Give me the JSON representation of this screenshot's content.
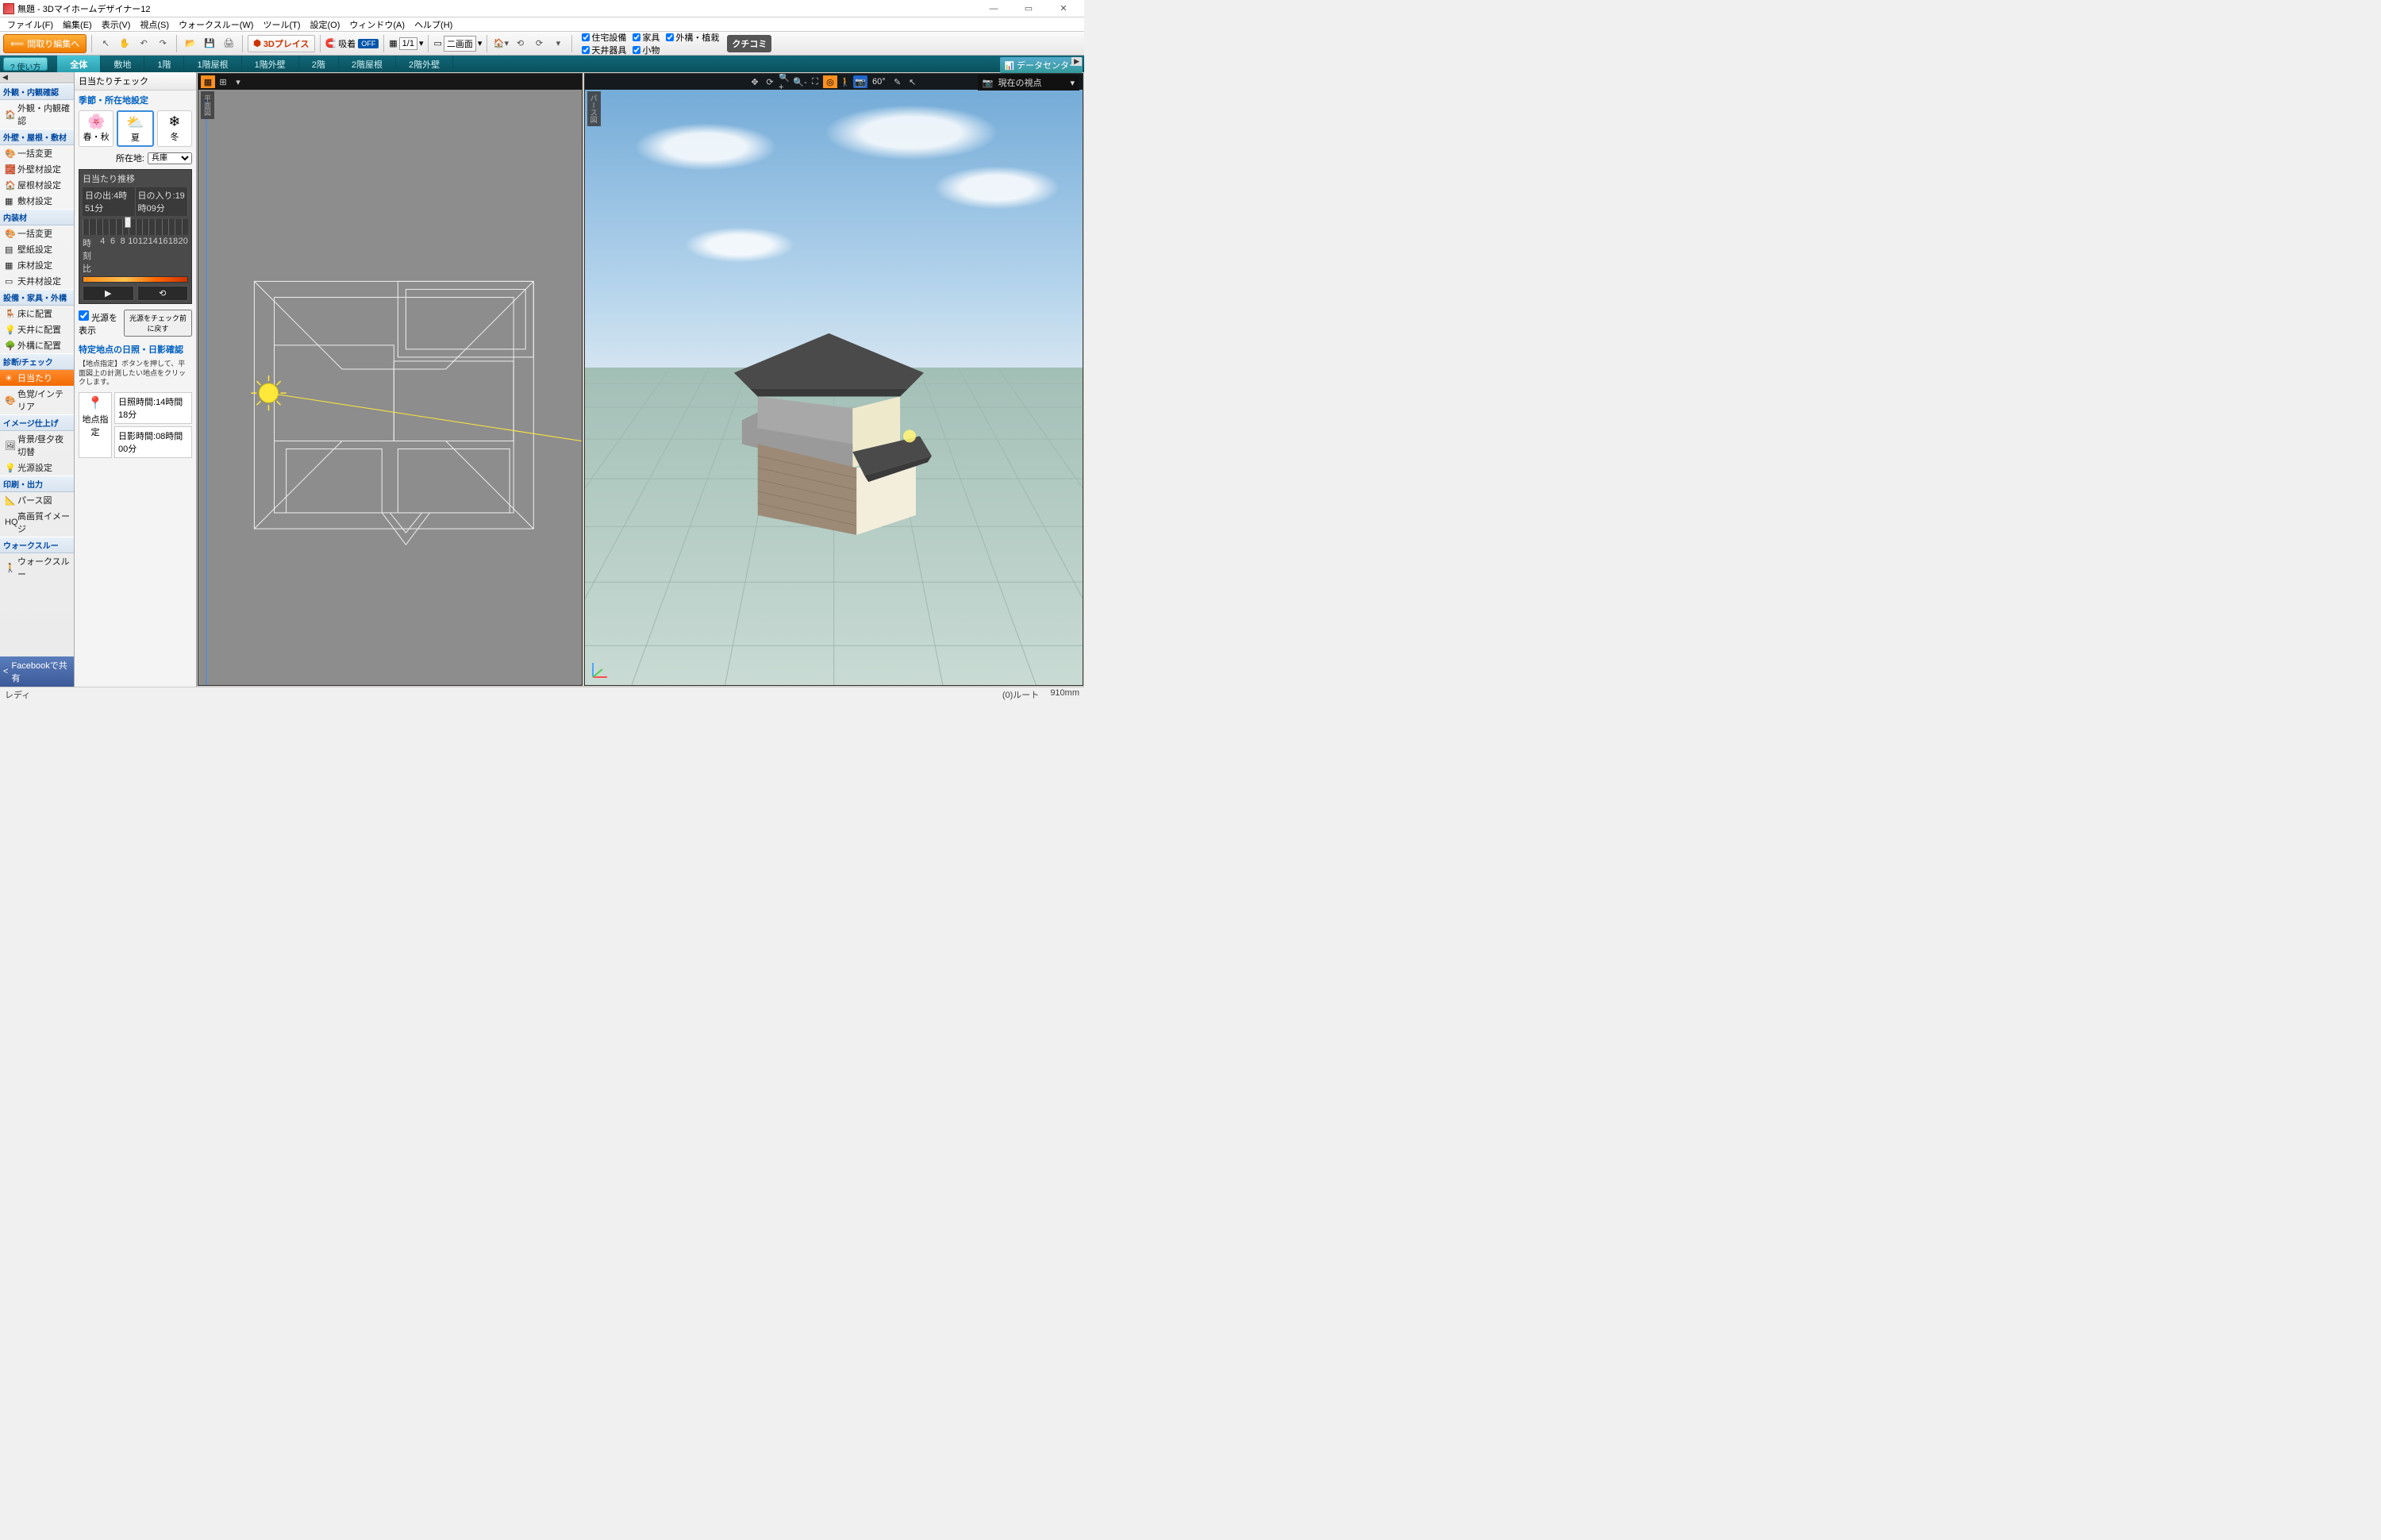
{
  "title": "無題 - 3Dマイホームデザイナー12",
  "menubar": [
    "ファイル(F)",
    "編集(E)",
    "表示(V)",
    "視点(S)",
    "ウォークスルー(W)",
    "ツール(T)",
    "設定(O)",
    "ウィンドウ(A)",
    "ヘルプ(H)"
  ],
  "toolbar": {
    "back": "間取り編集へ",
    "threed_place": "3Dプレイス",
    "snap_label": "吸着",
    "snap_state": "OFF",
    "page": "1/1",
    "layout": "二画面",
    "checks_row1": [
      "住宅設備",
      "家具",
      "外構・植栽"
    ],
    "checks_row2": [
      "天井器具",
      "小物"
    ],
    "kuchikomi": "クチコミ"
  },
  "tabbar": {
    "how": "? 使い方",
    "tabs": [
      "全体",
      "敷地",
      "1階",
      "1階屋根",
      "1階外壁",
      "2階",
      "2階屋根",
      "2階外壁"
    ],
    "datacenter": "データセンター"
  },
  "left": {
    "groups": [
      {
        "title": "外観・内観確認",
        "items": [
          {
            "label": "外観・内観確認",
            "icon": "🏠"
          }
        ]
      },
      {
        "title": "外壁・屋根・敷材",
        "items": [
          {
            "label": "一括変更",
            "icon": "🎨"
          },
          {
            "label": "外壁材設定",
            "icon": "🧱"
          },
          {
            "label": "屋根材設定",
            "icon": "🏠"
          },
          {
            "label": "敷材設定",
            "icon": "▦"
          }
        ]
      },
      {
        "title": "内装材",
        "items": [
          {
            "label": "一括変更",
            "icon": "🎨"
          },
          {
            "label": "壁紙設定",
            "icon": "▤"
          },
          {
            "label": "床材設定",
            "icon": "▦"
          },
          {
            "label": "天井材設定",
            "icon": "▭"
          }
        ]
      },
      {
        "title": "設備・家具・外構",
        "items": [
          {
            "label": "床に配置",
            "icon": "🪑"
          },
          {
            "label": "天井に配置",
            "icon": "💡"
          },
          {
            "label": "外構に配置",
            "icon": "🌳"
          }
        ]
      },
      {
        "title": "診断/チェック",
        "items": [
          {
            "label": "日当たり",
            "icon": "☀",
            "selected": true
          },
          {
            "label": "色覚/インテリア",
            "icon": "🎨"
          }
        ]
      },
      {
        "title": "イメージ仕上げ",
        "items": [
          {
            "label": "背景/昼夕夜切替",
            "icon": "🖼"
          },
          {
            "label": "光源設定",
            "icon": "💡"
          }
        ]
      },
      {
        "title": "印刷・出力",
        "items": [
          {
            "label": "パース図",
            "icon": "📐"
          },
          {
            "label": "高画質イメージ",
            "icon": "HQ"
          }
        ]
      },
      {
        "title": "ウォークスルー",
        "items": [
          {
            "label": "ウォークスルー",
            "icon": "🚶"
          }
        ]
      }
    ],
    "facebook": "Facebookで共有"
  },
  "prop": {
    "title": "日当たりチェック",
    "season_title": "季節・所在地設定",
    "seasons": [
      {
        "emoji": "🌸",
        "label": "春・秋"
      },
      {
        "emoji": "⛅",
        "label": "夏",
        "selected": true
      },
      {
        "emoji": "❄",
        "label": "冬"
      }
    ],
    "loc_label": "所在地:",
    "loc_value": "兵庫",
    "sun_title": "日当たり推移",
    "sunrise_label": "日の出:",
    "sunrise": "4時51分",
    "sunset_label": "日の入り:",
    "sunset": "19時09分",
    "hours_label": "時刻比",
    "hours": [
      "4",
      "6",
      "8",
      "10",
      "12",
      "14",
      "16",
      "18",
      "20"
    ],
    "show_light": "光源を表示",
    "reset_btn": "光源をチェック前に戻す",
    "spot_title": "特定地点の日照・日影確認",
    "spot_desc": "【地点指定】ボタンを押して、平面図上の計測したい地点をクリックします。",
    "spot_btn": "地点指定",
    "sunlight_time_label": "日照時間:",
    "sunlight_time": "14時間18分",
    "shadow_time_label": "日影時間:",
    "shadow_time": "08時間00分"
  },
  "view2d": {
    "label": "平面図",
    "angle": ""
  },
  "view3d": {
    "label": "パース図",
    "snapshot": "現在の視点",
    "angle": "60°"
  },
  "status": {
    "left": "レディ",
    "root": "(0)ルート",
    "dist": "910mm"
  }
}
